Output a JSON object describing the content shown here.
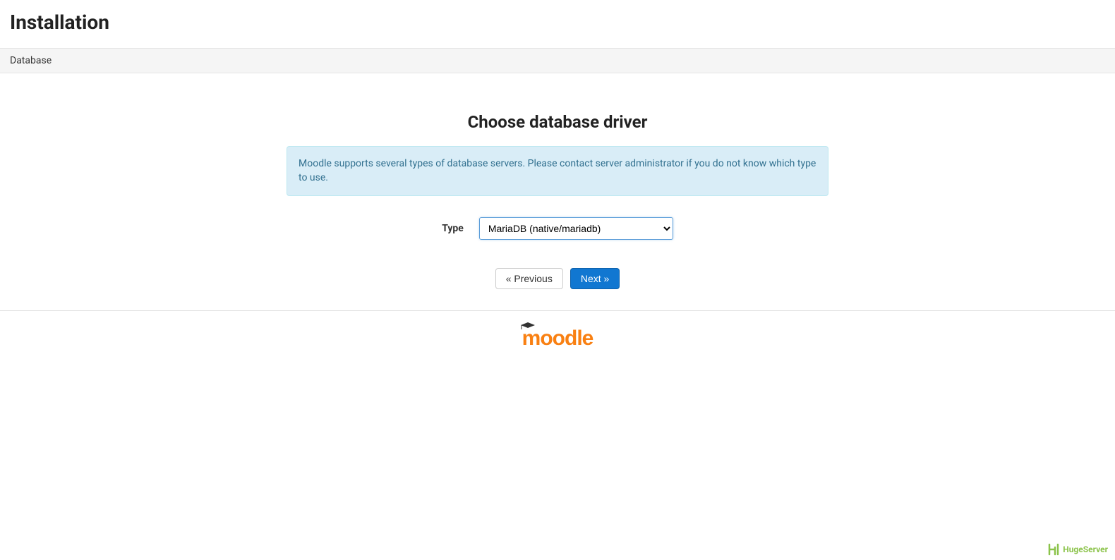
{
  "header": {
    "title": "Installation"
  },
  "breadcrumb": {
    "current": "Database"
  },
  "main": {
    "heading": "Choose database driver",
    "info_message": "Moodle supports several types of database servers. Please contact server administrator if you do not know which type to use.",
    "form": {
      "type_label": "Type",
      "type_selected": "MariaDB (native/mariadb)"
    },
    "buttons": {
      "previous": "« Previous",
      "next": "Next »"
    }
  },
  "footer": {
    "logo_text": "moodle"
  },
  "watermark": {
    "text": "HugeServer"
  }
}
